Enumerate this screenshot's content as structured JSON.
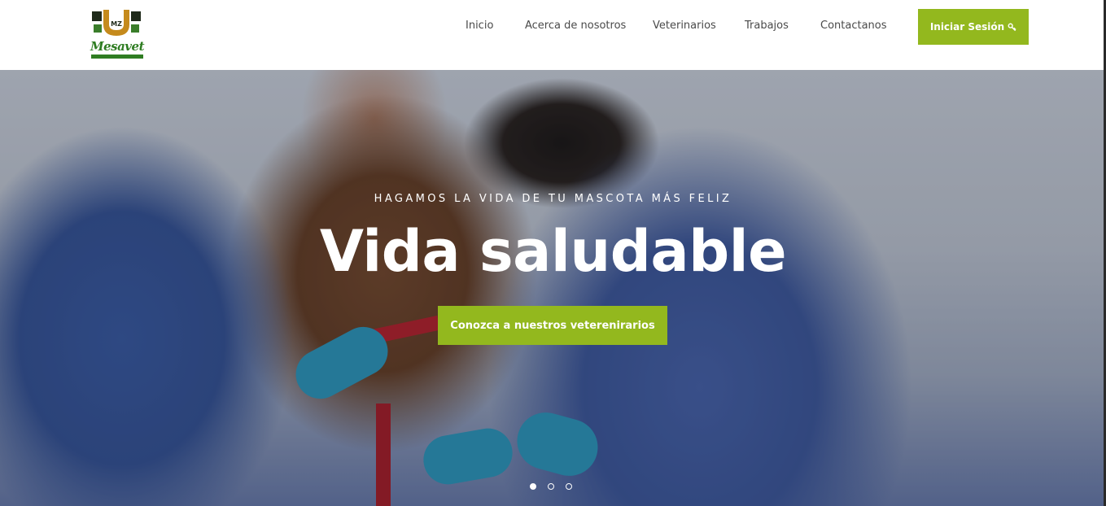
{
  "header": {
    "logo": {
      "wordmark": "Mesavet",
      "emblem_text": "MZ"
    },
    "nav": [
      {
        "label": "Inicio"
      },
      {
        "label": "Acerca de nosotros"
      },
      {
        "label": "Veterinarios"
      },
      {
        "label": "Trabajos"
      },
      {
        "label": "Contactanos"
      }
    ],
    "login_button": {
      "label": "Iniciar Sesión",
      "icon": "key-icon"
    }
  },
  "hero": {
    "kicker": "HAGAMOS LA VIDA DE TU MASCOTA MÁS FELIZ",
    "headline": "Vida saludable",
    "cta_label": "Conozca a nuestros veterenirarios",
    "slides": {
      "count": 3,
      "active": 1
    }
  },
  "colors": {
    "accent": "#93b81e",
    "brand_green": "#2f7d22",
    "nav_text": "#4a4a4a"
  }
}
